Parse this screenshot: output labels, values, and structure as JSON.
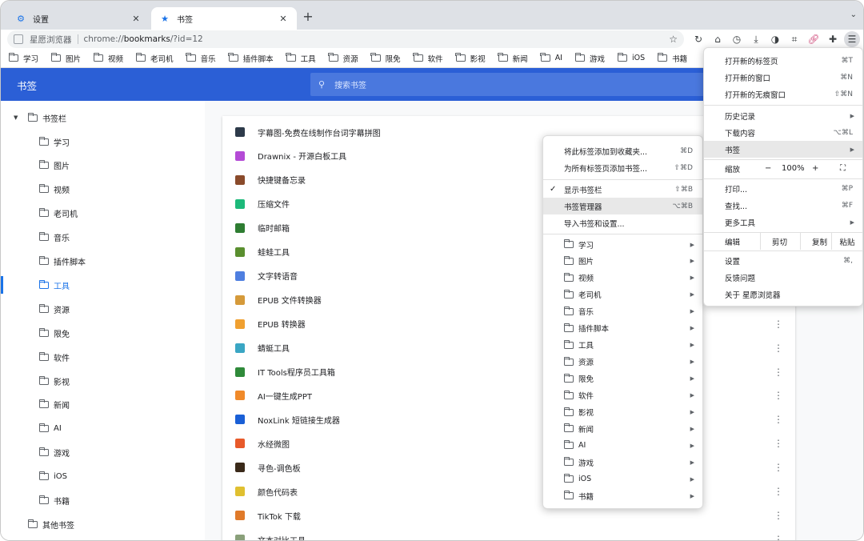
{
  "tabs": [
    {
      "title": "设置",
      "icon": "gear-icon"
    },
    {
      "title": "书签",
      "icon": "star-icon"
    }
  ],
  "omnibox": {
    "site_name": "星愿浏览器",
    "url_prefix": "chrome://",
    "url_host": "bookmarks",
    "url_rest": "/?id=12"
  },
  "bookmarks_bar": [
    "学习",
    "图片",
    "视频",
    "老司机",
    "音乐",
    "插件脚本",
    "工具",
    "资源",
    "限免",
    "软件",
    "影视",
    "新闻",
    "AI",
    "游戏",
    "iOS",
    "书籍"
  ],
  "manager": {
    "title": "书签",
    "search_placeholder": "搜索书签"
  },
  "sidebar": {
    "root": "书签栏",
    "folders": [
      "学习",
      "图片",
      "视频",
      "老司机",
      "音乐",
      "插件脚本",
      "工具",
      "资源",
      "限免",
      "软件",
      "影视",
      "新闻",
      "AI",
      "游戏",
      "iOS",
      "书籍"
    ],
    "active": "工具",
    "other": "其他书签"
  },
  "bookmarks": [
    {
      "title": "字幕图-免费在线制作台词字幕拼图",
      "color": "#2d3a4a"
    },
    {
      "title": "Drawnix - 开源白板工具",
      "color": "#b44bd6"
    },
    {
      "title": "快捷键备忘录",
      "color": "#8a4b2b"
    },
    {
      "title": "压缩文件",
      "color": "#1db97a"
    },
    {
      "title": "临时邮箱",
      "color": "#2e7d32"
    },
    {
      "title": "蛙蛙工具",
      "color": "#5a8f2f"
    },
    {
      "title": "文字转语音",
      "color": "#4f7fe0"
    },
    {
      "title": "EPUB 文件转换器",
      "color": "#d59a3a"
    },
    {
      "title": "EPUB 转换器",
      "color": "#f0a030"
    },
    {
      "title": "蜻蜓工具",
      "color": "#3aa6c4"
    },
    {
      "title": "IT Tools程序员工具箱",
      "color": "#2f8a3a"
    },
    {
      "title": "AI一键生成PPT",
      "color": "#f08a2a"
    },
    {
      "title": "NoxLink 短链接生成器",
      "color": "#1a5fd6"
    },
    {
      "title": "水经微图",
      "color": "#e85a2a"
    },
    {
      "title": "寻色-调色板",
      "color": "#3a2a1a"
    },
    {
      "title": "颜色代码表",
      "color": "#e0c030"
    },
    {
      "title": "TikTok 下载",
      "color": "#e07a2a"
    },
    {
      "title": "文本对比工具",
      "color": "#8aa07a"
    }
  ],
  "main_menu": {
    "items": [
      {
        "label": "打开新的标签页",
        "shortcut": "⌘T"
      },
      {
        "label": "打开新的窗口",
        "shortcut": "⌘N"
      },
      {
        "label": "打开新的无痕窗口",
        "shortcut": "⇧⌘N"
      },
      {
        "label": "历史记录",
        "shortcut": ""
      },
      {
        "label": "下载内容",
        "shortcut": "⌥⌘L"
      },
      {
        "label": "书签",
        "shortcut": ""
      },
      {
        "label": "打印...",
        "shortcut": "⌘P"
      },
      {
        "label": "查找...",
        "shortcut": "⌘F"
      },
      {
        "label": "更多工具",
        "shortcut": ""
      },
      {
        "label": "设置",
        "shortcut": "⌘,"
      },
      {
        "label": "反馈问题",
        "shortcut": ""
      },
      {
        "label": "关于 星愿浏览器",
        "shortcut": ""
      }
    ],
    "zoom": {
      "label": "缩放",
      "minus": "−",
      "value": "100%",
      "plus": "+"
    },
    "edit": {
      "label": "编辑",
      "cut": "剪切",
      "copy": "复制",
      "paste": "粘贴"
    }
  },
  "bookmark_menu": {
    "items": [
      {
        "label": "将此标签添加到收藏夹...",
        "shortcut": "⌘D"
      },
      {
        "label": "为所有标签页添加书签...",
        "shortcut": "⇧⌘D"
      },
      {
        "label": "显示书签栏",
        "shortcut": "⇧⌘B"
      },
      {
        "label": "书签管理器",
        "shortcut": "⌥⌘B"
      },
      {
        "label": "导入书签和设置...",
        "shortcut": ""
      }
    ],
    "folders": [
      "学习",
      "图片",
      "视频",
      "老司机",
      "音乐",
      "插件脚本",
      "工具",
      "资源",
      "限免",
      "软件",
      "影视",
      "新闻",
      "AI",
      "游戏",
      "iOS",
      "书籍"
    ]
  }
}
